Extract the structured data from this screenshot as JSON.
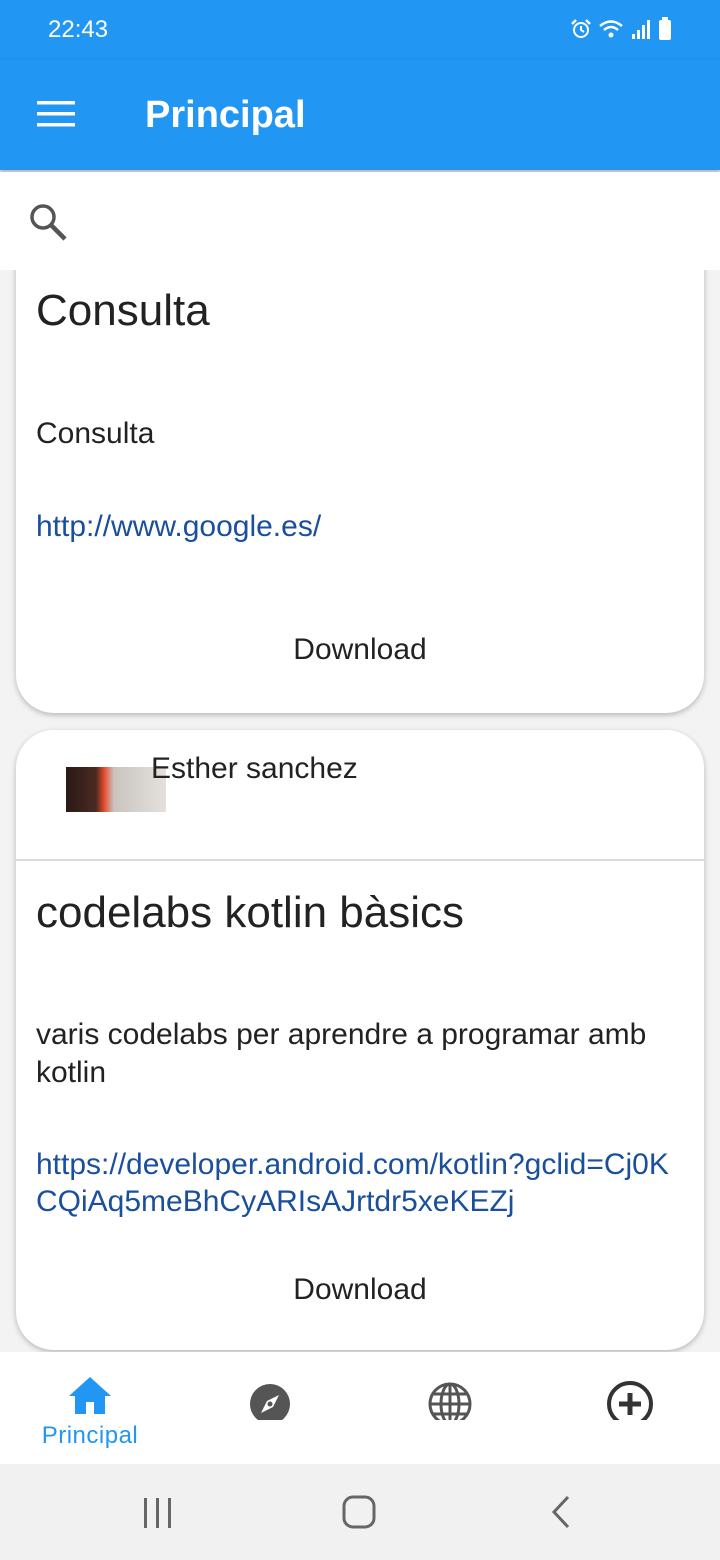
{
  "status_bar": {
    "time": "22:43",
    "icons": [
      "alarm-icon",
      "wifi-icon",
      "signal-icon",
      "battery-icon"
    ]
  },
  "app_bar": {
    "title": "Principal",
    "menu_icon": "hamburger-menu-icon",
    "color": "#2196F3"
  },
  "search": {
    "icon": "search-icon",
    "placeholder": ""
  },
  "posts": [
    {
      "author": "",
      "title": "Consulta",
      "description": "Consulta",
      "link": "http://www.google.es/",
      "action": "Download"
    },
    {
      "author": "Esther sanchez",
      "title": "codelabs kotlin bàsics",
      "description": "varis codelabs per aprendre a programar amb kotlin",
      "link": "https://developer.android.com/kotlin?gclid=Cj0KCQiAq5meBhCyARIsAJrtdr5xeKEZj",
      "action": "Download"
    }
  ],
  "bottom_nav": {
    "items": [
      {
        "label": "Principal",
        "icon": "home-icon",
        "active": true
      },
      {
        "label": "",
        "icon": "compass-icon",
        "active": false
      },
      {
        "label": "",
        "icon": "globe-icon",
        "active": false
      },
      {
        "label": "",
        "icon": "add-circle-icon",
        "active": false
      }
    ],
    "active_color": "#2196F3",
    "inactive_color": "#555555"
  },
  "system_nav": {
    "buttons": [
      "recents-icon",
      "home-button-icon",
      "back-icon"
    ]
  }
}
